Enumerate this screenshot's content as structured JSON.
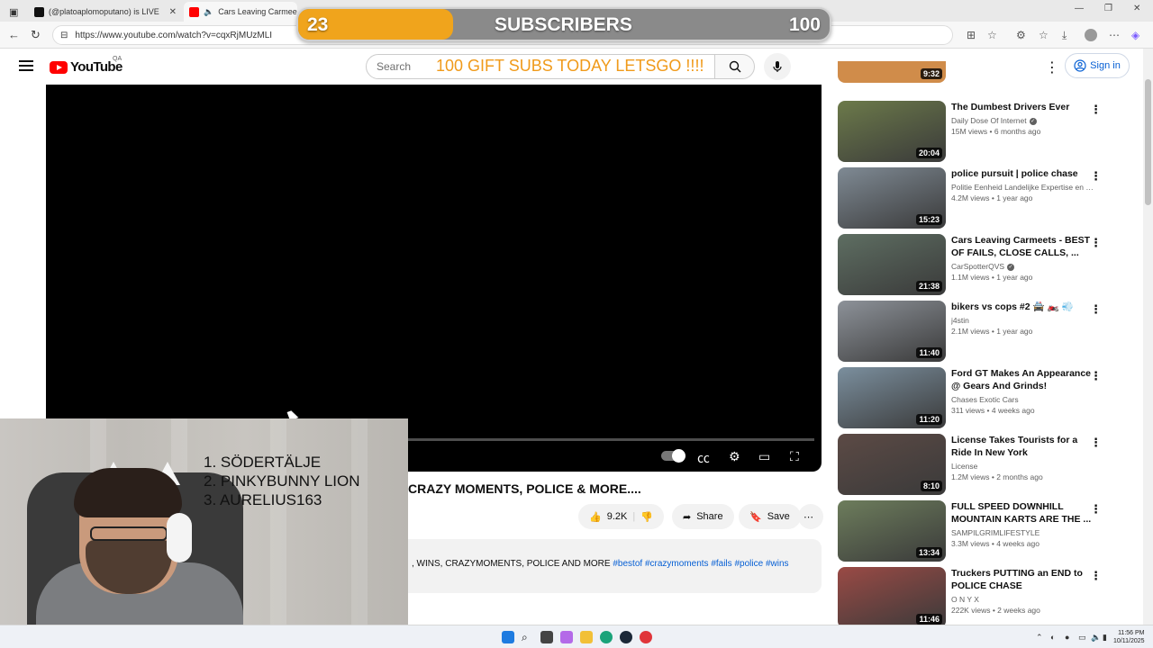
{
  "browser": {
    "tabs": [
      {
        "label": "(@platoaplomoputano) is LIVE",
        "icon": "tiktok-icon",
        "color": "#111111"
      },
      {
        "label": "Cars Leaving Carmeet",
        "icon": "youtube-icon",
        "color": "#ff0000"
      }
    ],
    "url": "https://www.youtube.com/watch?v=cqxRjMUzMLI"
  },
  "overlay": {
    "sub_current": "23",
    "sub_label": "SUBSCRIBERS",
    "sub_goal": "100",
    "sub_progress": 0.23,
    "gift_banner": "100 GIFT SUBS TODAY LETSGO !!!!",
    "ranks": [
      "1.  SÖDERTÄLJE",
      "2.  PINKYBUNNY LION",
      "3.  AURELIUS163"
    ]
  },
  "youtube": {
    "logo_text": "YouTube",
    "country_code": "QA",
    "search_placeholder": "Search",
    "sign_in": "Sign in"
  },
  "video": {
    "title": "CRAZY MOMENTS, POLICE & MORE....",
    "likes": "9.2K",
    "share": "Share",
    "save": "Save",
    "description_text": ", WINS, CRAZYMOMENTS, POLICE AND MORE ",
    "hashtags": [
      "#bestof",
      "#crazymoments",
      "#fails",
      "#police",
      "#wins"
    ]
  },
  "sidebar": {
    "top_partial_duration": "9:32",
    "items": [
      {
        "title": "The Dumbest Drivers Ever",
        "channel": "Daily Dose Of Internet",
        "verified": true,
        "views": "15M views • 6 months ago",
        "duration": "20:04",
        "thumb": "#6c7a4a"
      },
      {
        "title": "police pursuit | police chase",
        "channel": "Politie Eenheid Landelijke Expertise en O...",
        "verified": false,
        "views": "4.2M views • 1 year ago",
        "duration": "15:23",
        "thumb": "#7f8a94"
      },
      {
        "title": "Cars Leaving Carmeets  - BEST OF FAILS, CLOSE CALLS, ...",
        "channel": "CarSpotterQVS",
        "verified": true,
        "views": "1.1M views • 1 year ago",
        "duration": "21:38",
        "thumb": "#5e6e62"
      },
      {
        "title": "bikers vs cops #2 🚔 🏍️ 💨",
        "channel": "j4stin",
        "verified": false,
        "views": "2.1M views • 1 year ago",
        "duration": "11:40",
        "thumb": "#8d9299"
      },
      {
        "title": "Ford GT Makes An Appearance @ Gears And Grinds!",
        "channel": "Chases Exotic Cars",
        "verified": false,
        "views": "311 views • 4 weeks ago",
        "duration": "11:20",
        "thumb": "#7b8f9e"
      },
      {
        "title": "License Takes Tourists for a Ride In New York",
        "channel": "License",
        "verified": false,
        "views": "1.2M views • 2 months ago",
        "duration": "8:10",
        "thumb": "#5c4a45"
      },
      {
        "title": "FULL SPEED DOWNHILL MOUNTAIN KARTS ARE THE ...",
        "channel": "SAMPILGRIMLIFESTYLE",
        "verified": false,
        "views": "3.3M views • 4 weeks ago",
        "duration": "13:34",
        "thumb": "#6d7d5c"
      },
      {
        "title": "Truckers PUTTING an END to POLICE CHASE",
        "channel": "O N Y X",
        "verified": false,
        "views": "222K views • 2 weeks ago",
        "duration": "11:46",
        "thumb": "#9a4a45"
      }
    ]
  },
  "taskbar": {
    "time": "11:56 PM",
    "date": "10/11/2025"
  }
}
